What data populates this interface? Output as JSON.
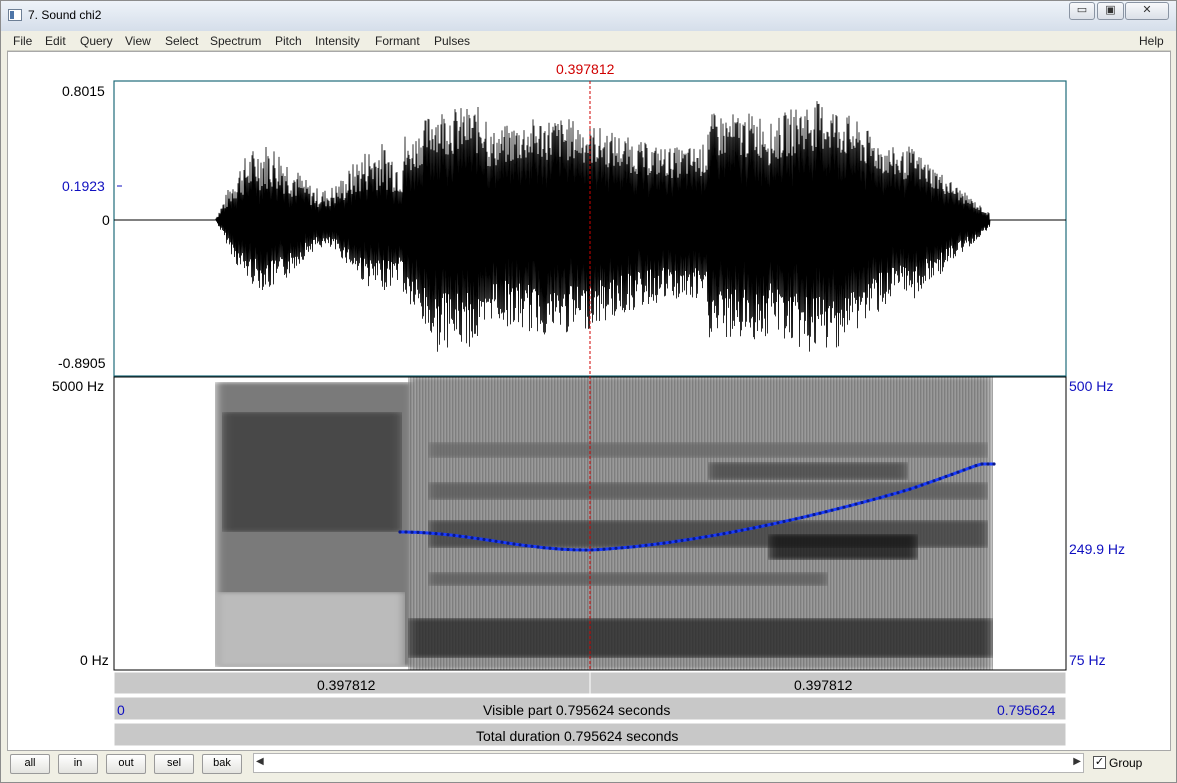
{
  "window": {
    "title": "7. Sound chi2"
  },
  "window_buttons": {
    "minimize": "▭",
    "maximize": "▣",
    "close": "✕"
  },
  "menu": {
    "items": [
      "File",
      "Edit",
      "Query",
      "View",
      "Select",
      "Spectrum",
      "Pitch",
      "Intensity",
      "Formant",
      "Pulses"
    ],
    "help": "Help"
  },
  "cursor": {
    "time_label": "0.397812"
  },
  "waveform": {
    "y_max": "0.8015",
    "y_mark": "0.1923",
    "y_zero": "0",
    "y_min": "-0.8905"
  },
  "spectrogram": {
    "freq_top": "5000 Hz",
    "freq_bottom": "0 Hz"
  },
  "pitch": {
    "top": "500 Hz",
    "mid": "249.9 Hz",
    "bottom": "75 Hz"
  },
  "time_bar": {
    "left": "0.397812",
    "right": "0.397812"
  },
  "visible_bar": {
    "start": "0",
    "label": "Visible part 0.795624 seconds",
    "end": "0.795624"
  },
  "total_bar": {
    "label": "Total duration 0.795624 seconds"
  },
  "buttons": {
    "all": "all",
    "in": "in",
    "out": "out",
    "sel": "sel",
    "bak": "bak"
  },
  "scroll": {
    "left_arrow": "◀",
    "right_arrow": "▶"
  },
  "group": {
    "label": "Group",
    "checked": "✓"
  },
  "colors": {
    "cursor": "#d00000",
    "pitch": "#1a3cff",
    "axis_blue": "#1010c0"
  }
}
